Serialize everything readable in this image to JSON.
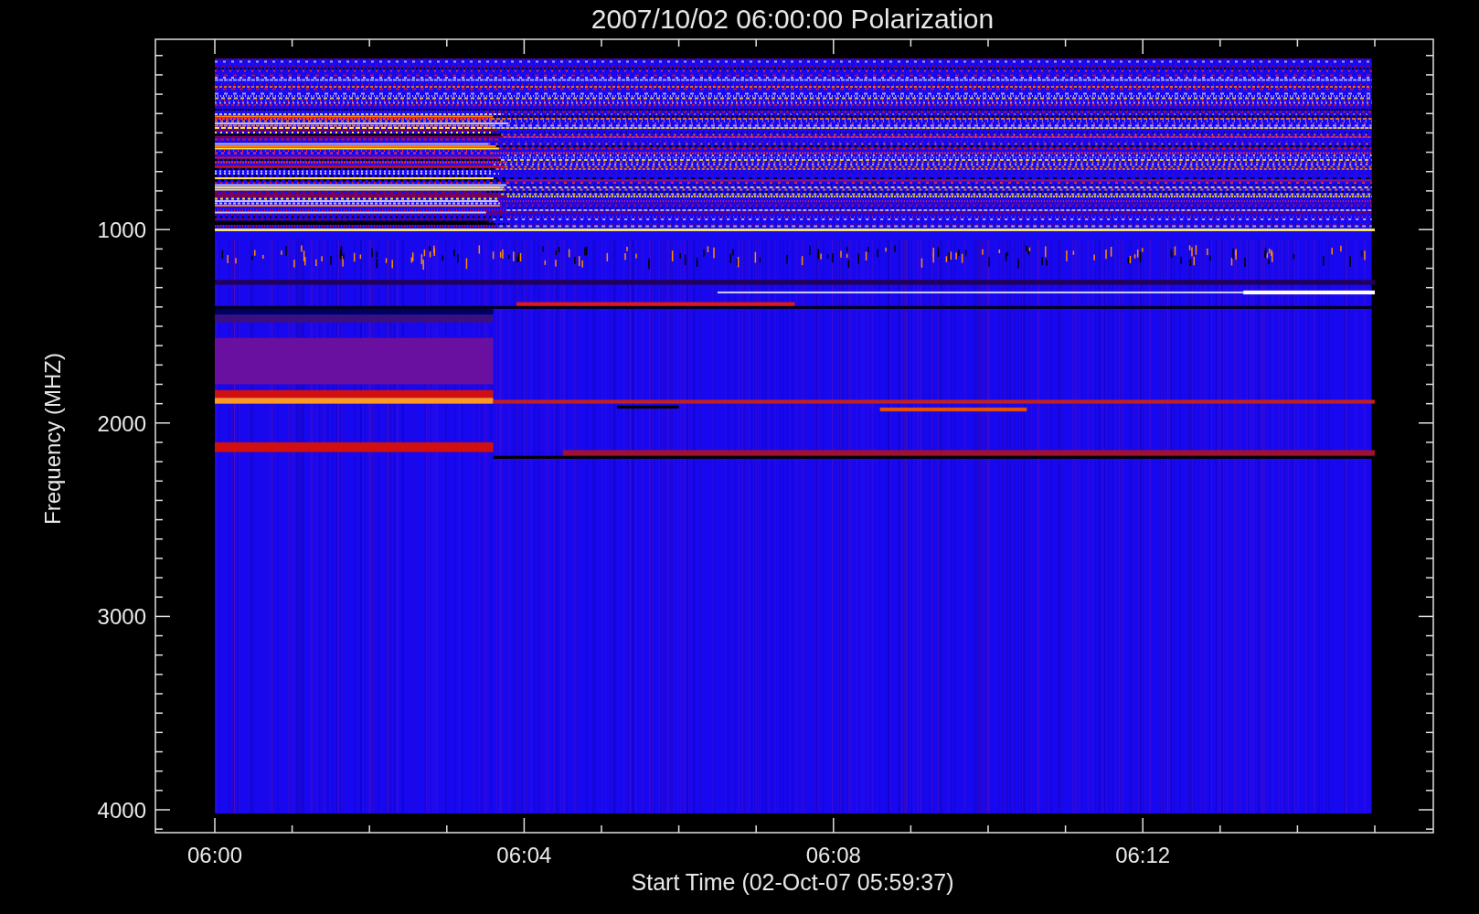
{
  "title": "2007/10/02 06:00:00 Polarization",
  "y_axis": {
    "label": "Frequency (MHZ)",
    "tick_labels": [
      "1000",
      "2000",
      "3000",
      "4000"
    ]
  },
  "x_axis": {
    "label": "Start Time (02-Oct-07 05:59:37)",
    "tick_labels": [
      "06:00",
      "06:04",
      "06:08",
      "06:12"
    ]
  }
}
